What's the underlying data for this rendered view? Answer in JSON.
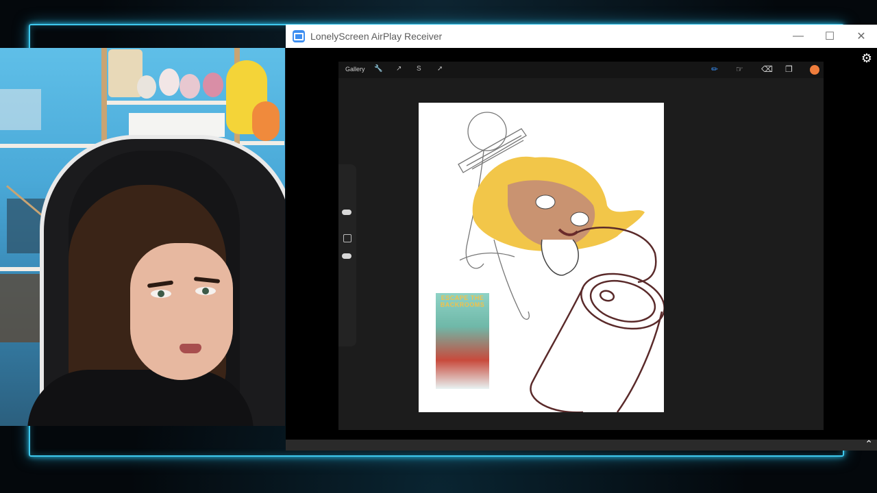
{
  "window": {
    "title": "LonelyScreen AirPlay Receiver",
    "minimize_icon": "minimize-icon",
    "maximize_icon": "maximize-icon",
    "close_icon": "close-icon",
    "settings_icon": "gear-icon",
    "collapse_icon": "chevron-up-icon"
  },
  "procreate": {
    "gallery_label": "Gallery",
    "left_tools": [
      "wrench-icon",
      "magic-wand-icon",
      "selection-icon",
      "transform-icon"
    ],
    "right_tools": [
      "brush-icon",
      "smudge-icon",
      "eraser-icon",
      "layers-icon"
    ],
    "active_tool": "brush-icon",
    "current_color": "#ef7d3c"
  },
  "poster": {
    "text": "ESCAPE THE BACKROOMS"
  },
  "colors": {
    "neon_frame": "#3fc9ee",
    "hair": "#f2c649",
    "can_outline": "#5a2a2a"
  }
}
